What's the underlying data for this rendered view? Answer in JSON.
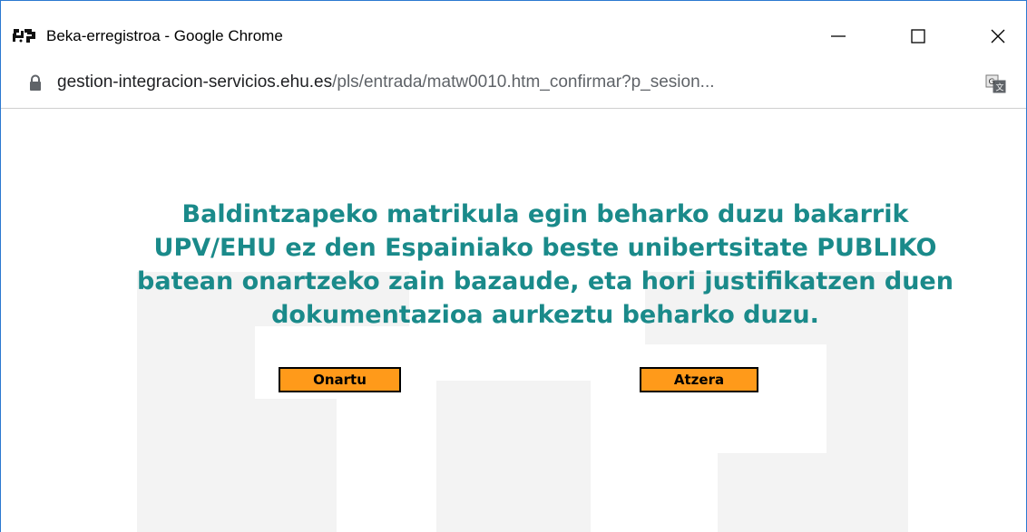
{
  "window": {
    "title": "Beka-erregistroa - Google Chrome",
    "controls": [
      "minimize-icon",
      "maximize-icon",
      "close-icon"
    ]
  },
  "address_bar": {
    "host": "gestion-integracion-servicios.ehu.es",
    "path": "/pls/entrada/matw0010.htm_confirmar?p_sesion..."
  },
  "message": {
    "lines": [
      "Baldintzapeko matrikula egin beharko duzu bakarrik",
      "UPV/EHU ez den Espainiako beste unibertsitate PUBLIKO",
      "batean onartzeko zain bazaude, eta hori justifikatzen duen",
      "dokumentazioa aurkeztu beharko duzu."
    ]
  },
  "buttons": {
    "accept_label": "Onartu",
    "back_label": "Atzera"
  },
  "colors": {
    "message_text": "#1a8a8a",
    "button_fill": "#ff9a1a",
    "window_border": "#2b79d0"
  }
}
